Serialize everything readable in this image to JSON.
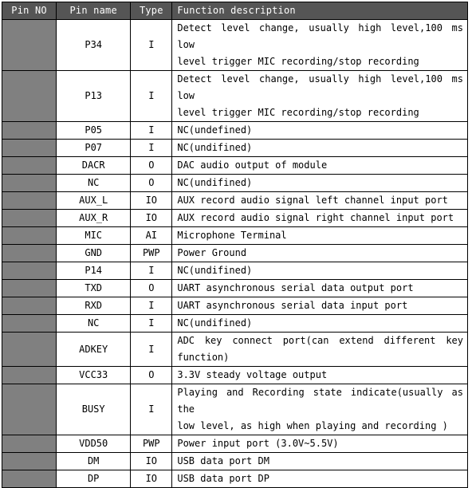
{
  "table": {
    "name": "pin-definition-table",
    "columns": [
      {
        "key": "pin_no",
        "label": "Pin NO",
        "align": "center"
      },
      {
        "key": "pin_name",
        "label": "Pin name",
        "align": "center"
      },
      {
        "key": "type",
        "label": "Type",
        "align": "center"
      },
      {
        "key": "desc",
        "label": "Function description",
        "align": "left"
      }
    ],
    "colors": {
      "header_background": "#555555",
      "header_text": "#ffffff",
      "pin_no_cell_background": "#808080",
      "cell_background": "#ffffff",
      "cell_text": "#000000",
      "border": "#000000"
    },
    "rows": [
      {
        "pin_no": "",
        "pin_name": "P34",
        "type": "I",
        "desc_lines": [
          "Detect level change, usually high level,100 ms low",
          "level trigger MIC recording/stop recording"
        ]
      },
      {
        "pin_no": "",
        "pin_name": "P13",
        "type": "I",
        "desc_lines": [
          "Detect level change, usually high level,100 ms low",
          "level trigger MIC recording/stop recording"
        ]
      },
      {
        "pin_no": "",
        "pin_name": "P05",
        "type": "I",
        "desc_lines": [
          "NC(undefined)"
        ]
      },
      {
        "pin_no": "",
        "pin_name": "P07",
        "type": "I",
        "desc_lines": [
          "NC(undifined)"
        ]
      },
      {
        "pin_no": "",
        "pin_name": "DACR",
        "type": "O",
        "desc_lines": [
          "DAC audio output of module"
        ]
      },
      {
        "pin_no": "",
        "pin_name": "NC",
        "type": "O",
        "desc_lines": [
          "NC(undifined)"
        ]
      },
      {
        "pin_no": "",
        "pin_name": "AUX_L",
        "type": "IO",
        "desc_lines": [
          "AUX record audio signal left channel input port"
        ]
      },
      {
        "pin_no": "",
        "pin_name": "AUX_R",
        "type": "IO",
        "desc_lines": [
          "AUX record audio signal right channel input port"
        ]
      },
      {
        "pin_no": "",
        "pin_name": "MIC",
        "type": "AI",
        "desc_lines": [
          "Microphone Terminal"
        ]
      },
      {
        "pin_no": "",
        "pin_name": "GND",
        "type": "PWP",
        "desc_lines": [
          "Power Ground"
        ]
      },
      {
        "pin_no": "",
        "pin_name": "P14",
        "type": "I",
        "desc_lines": [
          "NC(undifined)"
        ]
      },
      {
        "pin_no": "",
        "pin_name": "TXD",
        "type": "O",
        "desc_lines": [
          "UART asynchronous serial data output port"
        ]
      },
      {
        "pin_no": "",
        "pin_name": "RXD",
        "type": "I",
        "desc_lines": [
          "UART asynchronous serial data input port"
        ]
      },
      {
        "pin_no": "",
        "pin_name": "NC",
        "type": "I",
        "desc_lines": [
          "NC(undifined)"
        ]
      },
      {
        "pin_no": "",
        "pin_name": "ADKEY",
        "type": "I",
        "desc_lines": [
          "ADC key connect port(can extend different key",
          "function)"
        ]
      },
      {
        "pin_no": "",
        "pin_name": "VCC33",
        "type": "O",
        "desc_lines": [
          "3.3V steady voltage output"
        ]
      },
      {
        "pin_no": "",
        "pin_name": "BUSY",
        "type": "I",
        "desc_lines": [
          "Playing and Recording state indicate(usually as the",
          "low level, as high when playing and recording )"
        ]
      },
      {
        "pin_no": "",
        "pin_name": "VDD50",
        "type": "PWP",
        "desc_lines": [
          "Power input port (3.0V~5.5V)"
        ]
      },
      {
        "pin_no": "",
        "pin_name": "DM",
        "type": "IO",
        "desc_lines": [
          "USB data port DM"
        ]
      },
      {
        "pin_no": "",
        "pin_name": "DP",
        "type": "IO",
        "desc_lines": [
          "USB data port DP"
        ]
      }
    ]
  }
}
